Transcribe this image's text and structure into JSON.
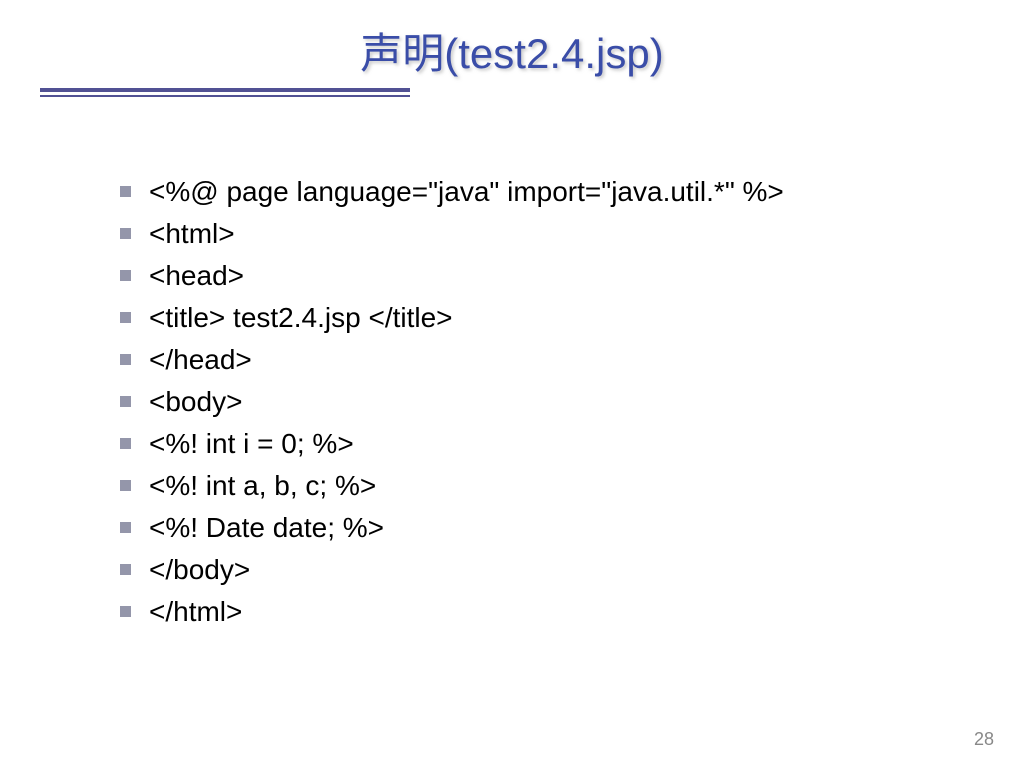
{
  "title": "声明(test2.4.jsp)",
  "code_lines": [
    "<%@ page language=\"java\" import=\"java.util.*\" %>",
    "<html>",
    "<head>",
    "<title> test2.4.jsp </title>",
    "</head>",
    "<body>",
    "<%! int i = 0; %>",
    "<%! int a, b, c; %>",
    "<%! Date date; %>",
    "</body>",
    "</html>"
  ],
  "page_number": "28"
}
